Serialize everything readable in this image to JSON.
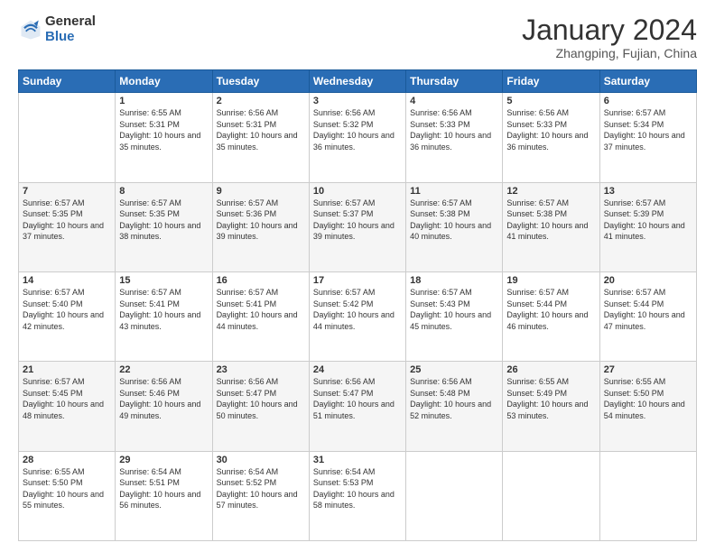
{
  "logo": {
    "general": "General",
    "blue": "Blue"
  },
  "header": {
    "month_year": "January 2024",
    "location": "Zhangping, Fujian, China"
  },
  "weekdays": [
    "Sunday",
    "Monday",
    "Tuesday",
    "Wednesday",
    "Thursday",
    "Friday",
    "Saturday"
  ],
  "weeks": [
    [
      null,
      {
        "day": 1,
        "sunrise": "6:55 AM",
        "sunset": "5:31 PM",
        "daylight": "10 hours and 35 minutes."
      },
      {
        "day": 2,
        "sunrise": "6:56 AM",
        "sunset": "5:31 PM",
        "daylight": "10 hours and 35 minutes."
      },
      {
        "day": 3,
        "sunrise": "6:56 AM",
        "sunset": "5:32 PM",
        "daylight": "10 hours and 36 minutes."
      },
      {
        "day": 4,
        "sunrise": "6:56 AM",
        "sunset": "5:33 PM",
        "daylight": "10 hours and 36 minutes."
      },
      {
        "day": 5,
        "sunrise": "6:56 AM",
        "sunset": "5:33 PM",
        "daylight": "10 hours and 36 minutes."
      },
      {
        "day": 6,
        "sunrise": "6:57 AM",
        "sunset": "5:34 PM",
        "daylight": "10 hours and 37 minutes."
      }
    ],
    [
      {
        "day": 7,
        "sunrise": "6:57 AM",
        "sunset": "5:35 PM",
        "daylight": "10 hours and 37 minutes."
      },
      {
        "day": 8,
        "sunrise": "6:57 AM",
        "sunset": "5:35 PM",
        "daylight": "10 hours and 38 minutes."
      },
      {
        "day": 9,
        "sunrise": "6:57 AM",
        "sunset": "5:36 PM",
        "daylight": "10 hours and 39 minutes."
      },
      {
        "day": 10,
        "sunrise": "6:57 AM",
        "sunset": "5:37 PM",
        "daylight": "10 hours and 39 minutes."
      },
      {
        "day": 11,
        "sunrise": "6:57 AM",
        "sunset": "5:38 PM",
        "daylight": "10 hours and 40 minutes."
      },
      {
        "day": 12,
        "sunrise": "6:57 AM",
        "sunset": "5:38 PM",
        "daylight": "10 hours and 41 minutes."
      },
      {
        "day": 13,
        "sunrise": "6:57 AM",
        "sunset": "5:39 PM",
        "daylight": "10 hours and 41 minutes."
      }
    ],
    [
      {
        "day": 14,
        "sunrise": "6:57 AM",
        "sunset": "5:40 PM",
        "daylight": "10 hours and 42 minutes."
      },
      {
        "day": 15,
        "sunrise": "6:57 AM",
        "sunset": "5:41 PM",
        "daylight": "10 hours and 43 minutes."
      },
      {
        "day": 16,
        "sunrise": "6:57 AM",
        "sunset": "5:41 PM",
        "daylight": "10 hours and 44 minutes."
      },
      {
        "day": 17,
        "sunrise": "6:57 AM",
        "sunset": "5:42 PM",
        "daylight": "10 hours and 44 minutes."
      },
      {
        "day": 18,
        "sunrise": "6:57 AM",
        "sunset": "5:43 PM",
        "daylight": "10 hours and 45 minutes."
      },
      {
        "day": 19,
        "sunrise": "6:57 AM",
        "sunset": "5:44 PM",
        "daylight": "10 hours and 46 minutes."
      },
      {
        "day": 20,
        "sunrise": "6:57 AM",
        "sunset": "5:44 PM",
        "daylight": "10 hours and 47 minutes."
      }
    ],
    [
      {
        "day": 21,
        "sunrise": "6:57 AM",
        "sunset": "5:45 PM",
        "daylight": "10 hours and 48 minutes."
      },
      {
        "day": 22,
        "sunrise": "6:56 AM",
        "sunset": "5:46 PM",
        "daylight": "10 hours and 49 minutes."
      },
      {
        "day": 23,
        "sunrise": "6:56 AM",
        "sunset": "5:47 PM",
        "daylight": "10 hours and 50 minutes."
      },
      {
        "day": 24,
        "sunrise": "6:56 AM",
        "sunset": "5:47 PM",
        "daylight": "10 hours and 51 minutes."
      },
      {
        "day": 25,
        "sunrise": "6:56 AM",
        "sunset": "5:48 PM",
        "daylight": "10 hours and 52 minutes."
      },
      {
        "day": 26,
        "sunrise": "6:55 AM",
        "sunset": "5:49 PM",
        "daylight": "10 hours and 53 minutes."
      },
      {
        "day": 27,
        "sunrise": "6:55 AM",
        "sunset": "5:50 PM",
        "daylight": "10 hours and 54 minutes."
      }
    ],
    [
      {
        "day": 28,
        "sunrise": "6:55 AM",
        "sunset": "5:50 PM",
        "daylight": "10 hours and 55 minutes."
      },
      {
        "day": 29,
        "sunrise": "6:54 AM",
        "sunset": "5:51 PM",
        "daylight": "10 hours and 56 minutes."
      },
      {
        "day": 30,
        "sunrise": "6:54 AM",
        "sunset": "5:52 PM",
        "daylight": "10 hours and 57 minutes."
      },
      {
        "day": 31,
        "sunrise": "6:54 AM",
        "sunset": "5:53 PM",
        "daylight": "10 hours and 58 minutes."
      },
      null,
      null,
      null
    ]
  ]
}
